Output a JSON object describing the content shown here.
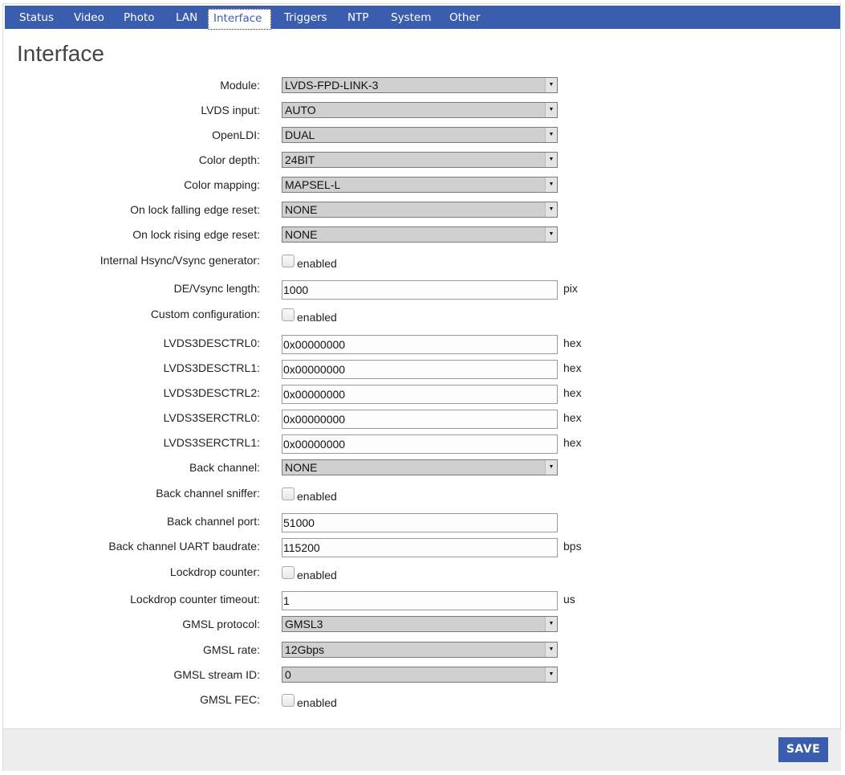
{
  "nav": {
    "tabs": [
      {
        "label": "Status"
      },
      {
        "label": "Video"
      },
      {
        "label": "Photo"
      },
      {
        "label": "LAN"
      },
      {
        "label": "Interface"
      },
      {
        "label": "Triggers"
      },
      {
        "label": "NTP"
      },
      {
        "label": "System"
      },
      {
        "label": "Other"
      }
    ],
    "active": "Interface"
  },
  "page": {
    "title": "Interface"
  },
  "form": {
    "module": {
      "label": "Module:",
      "value": "LVDS-FPD-LINK-3"
    },
    "lvds_input": {
      "label": "LVDS input:",
      "value": "AUTO"
    },
    "openldi": {
      "label": "OpenLDI:",
      "value": "DUAL"
    },
    "color_depth": {
      "label": "Color depth:",
      "value": "24BIT"
    },
    "color_mapping": {
      "label": "Color mapping:",
      "value": "MAPSEL-L"
    },
    "lock_falling": {
      "label": "On lock falling edge reset:",
      "value": "NONE"
    },
    "lock_rising": {
      "label": "On lock rising edge reset:",
      "value": "NONE"
    },
    "hsync_gen": {
      "label": "Internal Hsync/Vsync generator:",
      "checkbox_label": "enabled",
      "checked": false
    },
    "de_vsync": {
      "label": "DE/Vsync length:",
      "value": "1000",
      "unit": "pix"
    },
    "custom_config": {
      "label": "Custom configuration:",
      "checkbox_label": "enabled",
      "checked": false
    },
    "desctrl0": {
      "label": "LVDS3DESCTRL0:",
      "value": "0x00000000",
      "unit": "hex"
    },
    "desctrl1": {
      "label": "LVDS3DESCTRL1:",
      "value": "0x00000000",
      "unit": "hex"
    },
    "desctrl2": {
      "label": "LVDS3DESCTRL2:",
      "value": "0x00000000",
      "unit": "hex"
    },
    "serctrl0": {
      "label": "LVDS3SERCTRL0:",
      "value": "0x00000000",
      "unit": "hex"
    },
    "serctrl1": {
      "label": "LVDS3SERCTRL1:",
      "value": "0x00000000",
      "unit": "hex"
    },
    "back_channel": {
      "label": "Back channel:",
      "value": "NONE"
    },
    "bc_sniffer": {
      "label": "Back channel sniffer:",
      "checkbox_label": "enabled",
      "checked": false
    },
    "bc_port": {
      "label": "Back channel port:",
      "value": "51000"
    },
    "bc_baud": {
      "label": "Back channel UART baudrate:",
      "value": "115200",
      "unit": "bps"
    },
    "lockdrop": {
      "label": "Lockdrop counter:",
      "checkbox_label": "enabled",
      "checked": false
    },
    "lockdrop_timeout": {
      "label": "Lockdrop counter timeout:",
      "value": "1",
      "unit": "us"
    },
    "gmsl_protocol": {
      "label": "GMSL protocol:",
      "value": "GMSL3"
    },
    "gmsl_rate": {
      "label": "GMSL rate:",
      "value": "12Gbps"
    },
    "gmsl_stream": {
      "label": "GMSL stream ID:",
      "value": "0"
    },
    "gmsl_fec": {
      "label": "GMSL FEC:",
      "checkbox_label": "enabled",
      "checked": false
    }
  },
  "footer": {
    "save_label": "SAVE"
  },
  "icons": {
    "dropdown_arrow": "▼"
  },
  "colors": {
    "accent": "#3a5ead",
    "footer_bg": "#ededed",
    "select_bg": "#d0d0d0"
  }
}
